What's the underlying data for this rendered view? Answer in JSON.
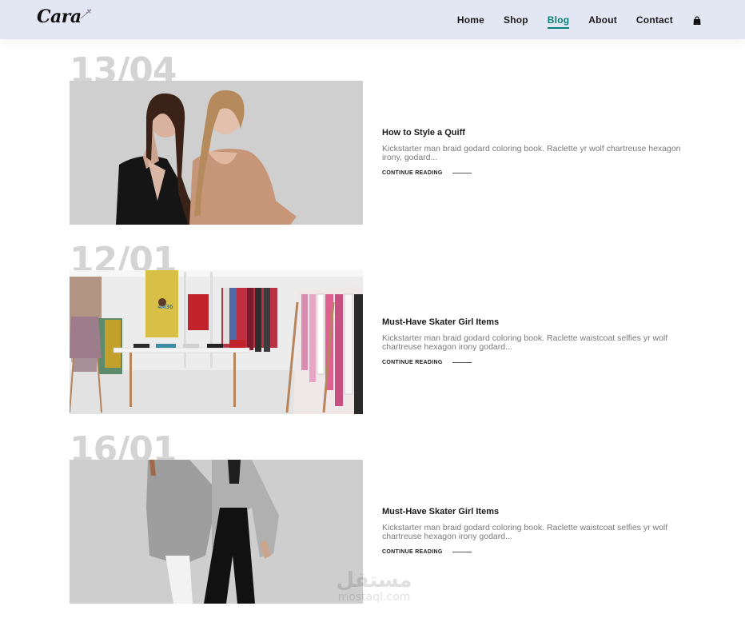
{
  "brand": {
    "name": "Cara"
  },
  "nav": {
    "items": [
      {
        "label": "Home"
      },
      {
        "label": "Shop"
      },
      {
        "label": "Blog",
        "active": true
      },
      {
        "label": "About"
      },
      {
        "label": "Contact"
      }
    ],
    "cart_icon": "shopping-bag-icon"
  },
  "colors": {
    "accent": "#088178",
    "header_bg": "#e3e6f3"
  },
  "posts": [
    {
      "date": "13/04",
      "title": "How to Style a Quiff",
      "excerpt": "Kickstarter man braid godard coloring book. Raclette yr wolf chartreuse hexagon irony, godard...",
      "cta": "CONTINUE READING"
    },
    {
      "date": "12/01",
      "title": "Must-Have Skater Girl Items",
      "excerpt": "Kickstarter man braid godard coloring book. Raclette waistcoat selfies yr wolf chartreuse hexagon irony godard...",
      "cta": "CONTINUE READING"
    },
    {
      "date": "16/01",
      "title": "Must-Have Skater Girl Items",
      "excerpt": "Kickstarter man braid godard coloring book. Raclette waistcoat selfies yr wolf chartreuse hexagon irony godard...",
      "cta": "CONTINUE READING"
    }
  ],
  "watermark": {
    "arabic": "مستقل",
    "latin": "mostaql.com"
  }
}
